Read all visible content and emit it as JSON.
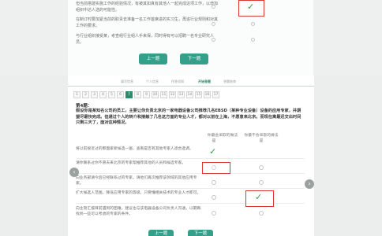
{
  "top": {
    "options": [
      {
        "text": "但当前搭建实施工作的经验情况，有被其如真有其他人一起完成这项工作，以增加组织中达人选的可能性。"
      },
      {
        "text": "在制订时要加紧当前的职责去准备一名工作首席进的实习生，再追行业规则和对其工作的要求。"
      },
      {
        "text": "与行业组织接受某，考查组行业组人手来保，同时得有可以招聘一名专业研究人员。"
      }
    ],
    "prev_label": "上一题",
    "next_label": "下一题"
  },
  "tabs": [
    {
      "label": "填写信息"
    },
    {
      "label": "个人信息"
    },
    {
      "label": "作答须知"
    },
    {
      "label": "开始答题"
    },
    {
      "label": "答题结束"
    }
  ],
  "pager": [
    "1",
    "2",
    "3",
    "4",
    "5",
    "6",
    "7",
    "8",
    "9",
    "10",
    "11",
    "12",
    "13",
    "14",
    "15",
    "16",
    "17"
  ],
  "question": {
    "number": "第4题：",
    "stem": "假设你是某知名公司的员工，主要让你负责北京的一家电器设备公司推荐几名EBSD（某种专业设备）设备的应用专家，并期望尽最快完成。但通过个人的转介和接触了几名这方面的专业人才，都对以前在上海，不愿意来北京。而现在离最迟交出时间只剩三天了，面对这种情况，",
    "col_yes": "你最会采取的做法",
    "col_no": "你最不会采取的做法",
    "col_yes_sub": "是",
    "col_no_sub": "是",
    "options": [
      {
        "text": "将以前接近过的那面家新候选一遍，查看是否有其他专家人适合选调。"
      },
      {
        "text": "请你联系过你不愿去来北京的专家帮推荐其他的人员和候选专家。"
      },
      {
        "text": "向业务部请今后已经联系过的专家，请他们再次推荐该领域的其他应用专家。"
      },
      {
        "text": "扩大候选人范围，降低应用专家的等级，只要懂相关技术的专业人才即可。"
      },
      {
        "text": "向主管汇报目前遇到的困难，建议也与该电器设备公司负责人沟通，以期再找到一些可以考虑的专家的条件。"
      }
    ],
    "prev_label": "上一题",
    "next_label": "下一题"
  },
  "colors": {
    "accent": "#35a08a",
    "selection": "#d63c35",
    "check": "#31a23a"
  }
}
